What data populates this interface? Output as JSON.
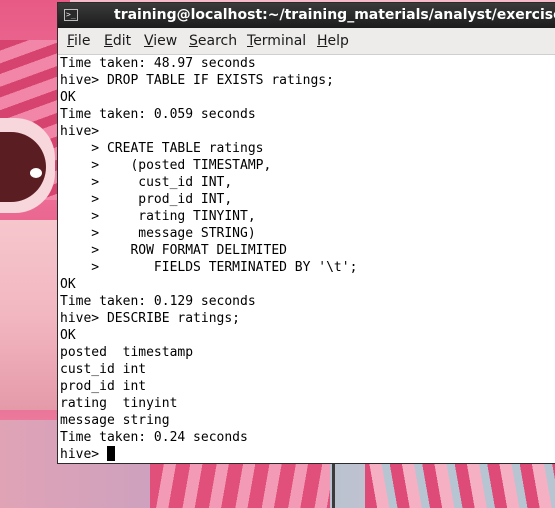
{
  "window": {
    "title": "training@localhost:~/training_materials/analyst/exercises"
  },
  "menu": {
    "file": "File",
    "edit": "Edit",
    "view": "View",
    "search": "Search",
    "terminal": "Terminal",
    "help": "Help"
  },
  "terminal": {
    "lines": [
      "Time taken: 48.97 seconds",
      "hive> DROP TABLE IF EXISTS ratings;",
      "OK",
      "Time taken: 0.059 seconds",
      "hive>",
      "    > CREATE TABLE ratings",
      "    >    (posted TIMESTAMP,",
      "    >     cust_id INT,",
      "    >     prod_id INT,",
      "    >     rating TINYINT,",
      "    >     message STRING)",
      "    >    ROW FORMAT DELIMITED",
      "    >       FIELDS TERMINATED BY '\\t';",
      "OK",
      "Time taken: 0.129 seconds",
      "hive> DESCRIBE ratings;",
      "OK",
      "posted  timestamp",
      "cust_id int",
      "prod_id int",
      "rating  tinyint",
      "message string",
      "Time taken: 0.24 seconds"
    ],
    "prompt": "hive> "
  },
  "colors": {
    "titlebar": "#1c1c1c",
    "menubar": "#edeceb",
    "terminal_bg": "#ffffff",
    "terminal_fg": "#000000"
  },
  "icons": {
    "app_icon": "terminal-icon"
  }
}
